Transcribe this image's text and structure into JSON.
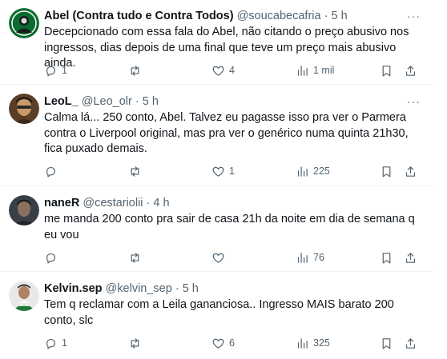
{
  "tweets": [
    {
      "name": "Abel (Contra tudo e Contra Todos)",
      "handle": "@soucabecafria",
      "separator": "·",
      "time": "5 h",
      "text": "Decepcionado com essa fala do Abel, não citando o preço abusivo nos ingressos, dias depois de uma final que teve um preço mais abusivo ainda.",
      "replies": "1",
      "retweets": "",
      "likes": "4",
      "views": "1 mil",
      "avatar_colors": {
        "bg": "#0b6b2e",
        "accent": "#ffffff"
      }
    },
    {
      "name": "LeoL_",
      "handle": "@Leo_olr",
      "separator": "·",
      "time": "5 h",
      "text": "Calma lá... 250 conto, Abel. Talvez eu pagasse isso pra ver o Parmera contra o Liverpool original, mas pra ver o genérico numa quinta 21h30, fica puxado demais.",
      "replies": "",
      "retweets": "",
      "likes": "1",
      "views": "225",
      "avatar_colors": {
        "bg": "#6b4a2c",
        "accent": "#c89a6a"
      }
    },
    {
      "name": "naneR",
      "handle": "@cestariolii",
      "separator": "·",
      "time": "4 h",
      "text": "me manda 200 conto pra sair de casa 21h da noite em dia de semana q eu vou",
      "replies": "",
      "retweets": "",
      "likes": "",
      "views": "76",
      "avatar_colors": {
        "bg": "#3a3f47",
        "accent": "#8a7260"
      }
    },
    {
      "name": "Kelvin.sep",
      "handle": "@kelvin_sep",
      "separator": "·",
      "time": "5 h",
      "text": "Tem q reclamar com a Leila gananciosa.. Ingresso MAIS barato 200 conto, slc",
      "replies": "1",
      "retweets": "",
      "likes": "6",
      "views": "325",
      "avatar_colors": {
        "bg": "#e8e8e8",
        "accent": "#1f7a3a"
      }
    }
  ],
  "colors": {
    "text": "#0f1419",
    "secondary": "#536471",
    "divider": "#eff3f4"
  },
  "icons": [
    "more-icon",
    "reply-icon",
    "retweet-icon",
    "like-icon",
    "views-icon",
    "bookmark-icon",
    "share-icon"
  ]
}
